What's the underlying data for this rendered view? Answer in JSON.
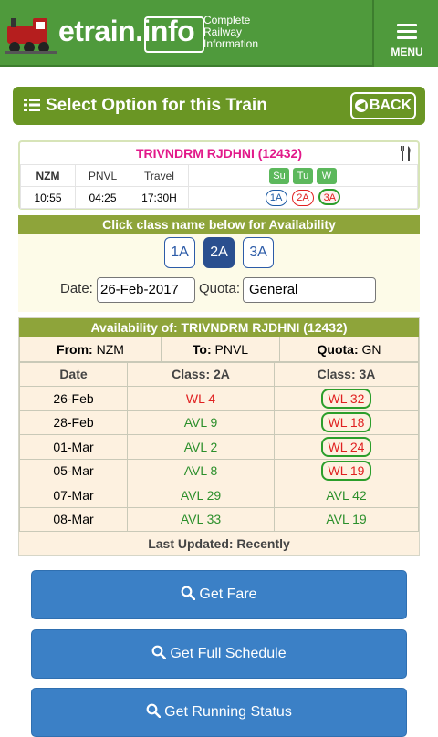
{
  "header": {
    "logo_text": "etrain.info",
    "tagline": [
      "Complete",
      "Railway",
      "Information"
    ],
    "menu_label": "MENU"
  },
  "option_bar": {
    "title": "Select Option for this Train",
    "back_label": "BACK"
  },
  "train": {
    "name": "TRIVNDRM RJDHNI (12432)",
    "columns": [
      "NZM",
      "PNVL",
      "Travel"
    ],
    "values": [
      "10:55",
      "04:25",
      "17:30H"
    ],
    "days": [
      "Su",
      "Tu",
      "W"
    ],
    "classes": [
      "1A",
      "2A",
      "3A"
    ]
  },
  "class_select": {
    "prompt": "Click class name below for Availability",
    "buttons": [
      "1A",
      "2A",
      "3A"
    ],
    "active": "2A",
    "date_label": "Date:",
    "date_value": "26-Feb-2017",
    "quota_label": "Quota:",
    "quota_value": "General"
  },
  "availability": {
    "title": "Availability of: TRIVNDRM RJDHNI (12432)",
    "from_label": "From:",
    "from_value": "NZM",
    "to_label": "To:",
    "to_value": "PNVL",
    "quota_label": "Quota:",
    "quota_value": "GN",
    "headers": [
      "Date",
      "Class: 2A",
      "Class: 3A"
    ],
    "rows": [
      {
        "date": "26-Feb",
        "c2a": "WL 4",
        "c3a": "WL 32"
      },
      {
        "date": "28-Feb",
        "c2a": "AVL 9",
        "c3a": "WL 18"
      },
      {
        "date": "01-Mar",
        "c2a": "AVL 2",
        "c3a": "WL 24"
      },
      {
        "date": "05-Mar",
        "c2a": "AVL 8",
        "c3a": "WL 19"
      },
      {
        "date": "07-Mar",
        "c2a": "AVL 29",
        "c3a": "AVL 42"
      },
      {
        "date": "08-Mar",
        "c2a": "AVL 33",
        "c3a": "AVL 19"
      }
    ],
    "last_updated": "Last Updated: Recently"
  },
  "actions": [
    "Get Fare",
    "Get Full Schedule",
    "Get Running Status"
  ],
  "colors": {
    "header_green": "#4f9a3c",
    "option_bar": "#6a9624",
    "section_bar": "#8ea43a",
    "waitlist_red": "#e02020",
    "available_green": "#2b8f2b",
    "button_blue": "#3b80c6"
  }
}
